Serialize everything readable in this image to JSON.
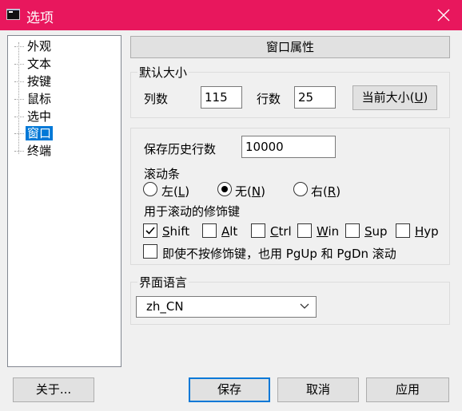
{
  "window": {
    "title": "选项",
    "icon": "terminal-icon",
    "title_bar_color": "#e8175d"
  },
  "tree": {
    "items": [
      {
        "label": "外观"
      },
      {
        "label": "文本"
      },
      {
        "label": "按键"
      },
      {
        "label": "鼠标"
      },
      {
        "label": "选中"
      },
      {
        "label": "窗口",
        "selected": true
      },
      {
        "label": "终端"
      }
    ]
  },
  "section": {
    "title": "窗口属性"
  },
  "default_size": {
    "title": "默认大小",
    "columns_label": "列数",
    "columns_value": "115",
    "rows_label": "行数",
    "rows_value": "25",
    "current_size_prefix": "当前大小(",
    "current_size_key": "U",
    "current_size_suffix": ")"
  },
  "history": {
    "label": "保存历史行数",
    "value": "10000"
  },
  "scrollbar": {
    "label": "滚动条",
    "options": [
      {
        "prefix": "左(",
        "key": "L",
        "suffix": ")",
        "checked": false
      },
      {
        "prefix": "无(",
        "key": "N",
        "suffix": ")",
        "checked": true
      },
      {
        "prefix": "右(",
        "key": "R",
        "suffix": ")",
        "checked": false
      }
    ]
  },
  "modifiers": {
    "label": "用于滚动的修饰键",
    "keys": [
      {
        "key": "S",
        "rest": "hift",
        "checked": true
      },
      {
        "key": "A",
        "rest": "lt",
        "checked": false
      },
      {
        "key": "C",
        "rest": "trl",
        "checked": false
      },
      {
        "key": "W",
        "rest": "in",
        "checked": false
      },
      {
        "key": "S",
        "rest": "up",
        "checked": false
      },
      {
        "key": "H",
        "rest": "yp",
        "checked": false
      }
    ],
    "pgupdn_label": "即使不按修饰键，也用 PgUp 和 PgDn 滚动",
    "pgupdn_checked": false
  },
  "language": {
    "title": "界面语言",
    "selected": "zh_CN"
  },
  "footer": {
    "about": "关于...",
    "save": "保存",
    "cancel": "取消",
    "apply": "应用"
  }
}
